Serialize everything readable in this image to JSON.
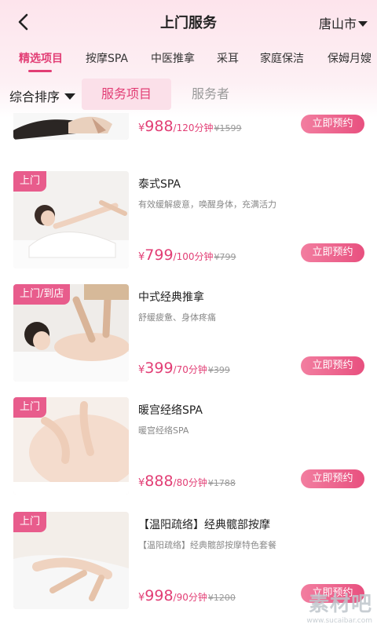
{
  "header": {
    "title": "上门服务",
    "city": "唐山市"
  },
  "categories": [
    {
      "label": "精选项目",
      "active": true
    },
    {
      "label": "按摩SPA",
      "active": false
    },
    {
      "label": "中医推拿",
      "active": false
    },
    {
      "label": "采耳",
      "active": false
    },
    {
      "label": "家庭保洁",
      "active": false
    },
    {
      "label": "保姆月嫂",
      "active": false
    }
  ],
  "filters": {
    "sort_label": "综合排序",
    "tab_services": "服务项目",
    "tab_providers": "服务者"
  },
  "items": [
    {
      "badge": "",
      "name": "",
      "desc": "",
      "currency": "¥",
      "price": "988",
      "unit": "/120分钟",
      "original": "¥1599",
      "button": "立即预约"
    },
    {
      "badge": "上门",
      "name": "泰式SPA",
      "desc": "有效缓解疲意，唤醒身体，充满活力",
      "currency": "¥",
      "price": "799",
      "unit": "/100分钟",
      "original": "¥799",
      "button": "立即预约"
    },
    {
      "badge": "上门/到店",
      "name": "中式经典推拿",
      "desc": "舒缓疲惫、身体疼痛",
      "currency": "¥",
      "price": "399",
      "unit": "/70分钟",
      "original": "¥399",
      "button": "立即预约"
    },
    {
      "badge": "上门",
      "name": "暖宫经络SPA",
      "desc": "暖宫经络SPA",
      "currency": "¥",
      "price": "888",
      "unit": "/80分钟",
      "original": "¥1788",
      "button": "立即预约"
    },
    {
      "badge": "上门",
      "name": "【温阳疏络】经典髋部按摩",
      "desc": "【温阳疏络】经典髋部按摩特色套餐",
      "currency": "¥",
      "price": "998",
      "unit": "/90分钟",
      "original": "¥1200",
      "button": "立即预约"
    }
  ],
  "watermark": {
    "brand": "素材吧",
    "url": "www.sucaibar.com"
  },
  "colors": {
    "accent": "#e23e75",
    "badge": "#e85c8c",
    "header_bg": "#fde4ec"
  }
}
